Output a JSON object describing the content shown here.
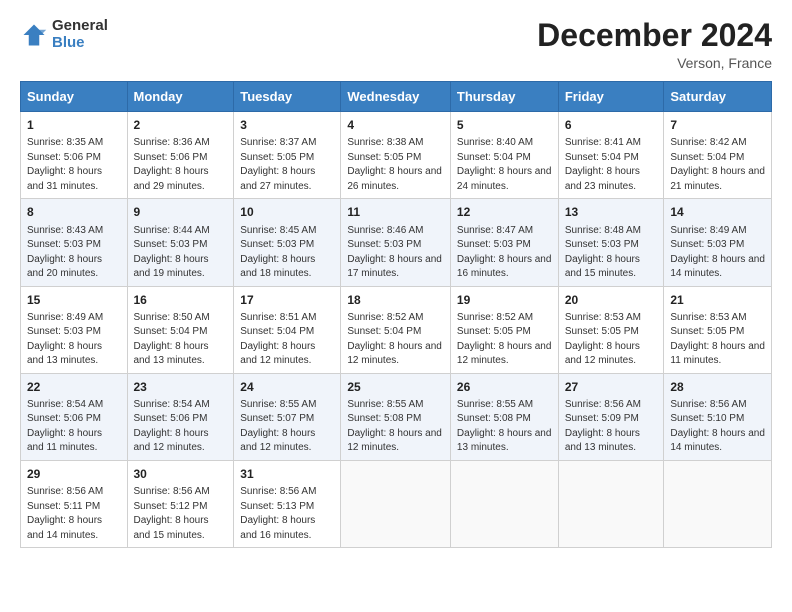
{
  "logo": {
    "general": "General",
    "blue": "Blue"
  },
  "header": {
    "title": "December 2024",
    "location": "Verson, France"
  },
  "weekdays": [
    "Sunday",
    "Monday",
    "Tuesday",
    "Wednesday",
    "Thursday",
    "Friday",
    "Saturday"
  ],
  "weeks": [
    [
      {
        "day": "1",
        "info": "Sunrise: 8:35 AM\nSunset: 5:06 PM\nDaylight: 8 hours and 31 minutes."
      },
      {
        "day": "2",
        "info": "Sunrise: 8:36 AM\nSunset: 5:06 PM\nDaylight: 8 hours and 29 minutes."
      },
      {
        "day": "3",
        "info": "Sunrise: 8:37 AM\nSunset: 5:05 PM\nDaylight: 8 hours and 27 minutes."
      },
      {
        "day": "4",
        "info": "Sunrise: 8:38 AM\nSunset: 5:05 PM\nDaylight: 8 hours and 26 minutes."
      },
      {
        "day": "5",
        "info": "Sunrise: 8:40 AM\nSunset: 5:04 PM\nDaylight: 8 hours and 24 minutes."
      },
      {
        "day": "6",
        "info": "Sunrise: 8:41 AM\nSunset: 5:04 PM\nDaylight: 8 hours and 23 minutes."
      },
      {
        "day": "7",
        "info": "Sunrise: 8:42 AM\nSunset: 5:04 PM\nDaylight: 8 hours and 21 minutes."
      }
    ],
    [
      {
        "day": "8",
        "info": "Sunrise: 8:43 AM\nSunset: 5:03 PM\nDaylight: 8 hours and 20 minutes."
      },
      {
        "day": "9",
        "info": "Sunrise: 8:44 AM\nSunset: 5:03 PM\nDaylight: 8 hours and 19 minutes."
      },
      {
        "day": "10",
        "info": "Sunrise: 8:45 AM\nSunset: 5:03 PM\nDaylight: 8 hours and 18 minutes."
      },
      {
        "day": "11",
        "info": "Sunrise: 8:46 AM\nSunset: 5:03 PM\nDaylight: 8 hours and 17 minutes."
      },
      {
        "day": "12",
        "info": "Sunrise: 8:47 AM\nSunset: 5:03 PM\nDaylight: 8 hours and 16 minutes."
      },
      {
        "day": "13",
        "info": "Sunrise: 8:48 AM\nSunset: 5:03 PM\nDaylight: 8 hours and 15 minutes."
      },
      {
        "day": "14",
        "info": "Sunrise: 8:49 AM\nSunset: 5:03 PM\nDaylight: 8 hours and 14 minutes."
      }
    ],
    [
      {
        "day": "15",
        "info": "Sunrise: 8:49 AM\nSunset: 5:03 PM\nDaylight: 8 hours and 13 minutes."
      },
      {
        "day": "16",
        "info": "Sunrise: 8:50 AM\nSunset: 5:04 PM\nDaylight: 8 hours and 13 minutes."
      },
      {
        "day": "17",
        "info": "Sunrise: 8:51 AM\nSunset: 5:04 PM\nDaylight: 8 hours and 12 minutes."
      },
      {
        "day": "18",
        "info": "Sunrise: 8:52 AM\nSunset: 5:04 PM\nDaylight: 8 hours and 12 minutes."
      },
      {
        "day": "19",
        "info": "Sunrise: 8:52 AM\nSunset: 5:05 PM\nDaylight: 8 hours and 12 minutes."
      },
      {
        "day": "20",
        "info": "Sunrise: 8:53 AM\nSunset: 5:05 PM\nDaylight: 8 hours and 12 minutes."
      },
      {
        "day": "21",
        "info": "Sunrise: 8:53 AM\nSunset: 5:05 PM\nDaylight: 8 hours and 11 minutes."
      }
    ],
    [
      {
        "day": "22",
        "info": "Sunrise: 8:54 AM\nSunset: 5:06 PM\nDaylight: 8 hours and 11 minutes."
      },
      {
        "day": "23",
        "info": "Sunrise: 8:54 AM\nSunset: 5:06 PM\nDaylight: 8 hours and 12 minutes."
      },
      {
        "day": "24",
        "info": "Sunrise: 8:55 AM\nSunset: 5:07 PM\nDaylight: 8 hours and 12 minutes."
      },
      {
        "day": "25",
        "info": "Sunrise: 8:55 AM\nSunset: 5:08 PM\nDaylight: 8 hours and 12 minutes."
      },
      {
        "day": "26",
        "info": "Sunrise: 8:55 AM\nSunset: 5:08 PM\nDaylight: 8 hours and 13 minutes."
      },
      {
        "day": "27",
        "info": "Sunrise: 8:56 AM\nSunset: 5:09 PM\nDaylight: 8 hours and 13 minutes."
      },
      {
        "day": "28",
        "info": "Sunrise: 8:56 AM\nSunset: 5:10 PM\nDaylight: 8 hours and 14 minutes."
      }
    ],
    [
      {
        "day": "29",
        "info": "Sunrise: 8:56 AM\nSunset: 5:11 PM\nDaylight: 8 hours and 14 minutes."
      },
      {
        "day": "30",
        "info": "Sunrise: 8:56 AM\nSunset: 5:12 PM\nDaylight: 8 hours and 15 minutes."
      },
      {
        "day": "31",
        "info": "Sunrise: 8:56 AM\nSunset: 5:13 PM\nDaylight: 8 hours and 16 minutes."
      },
      null,
      null,
      null,
      null
    ]
  ]
}
